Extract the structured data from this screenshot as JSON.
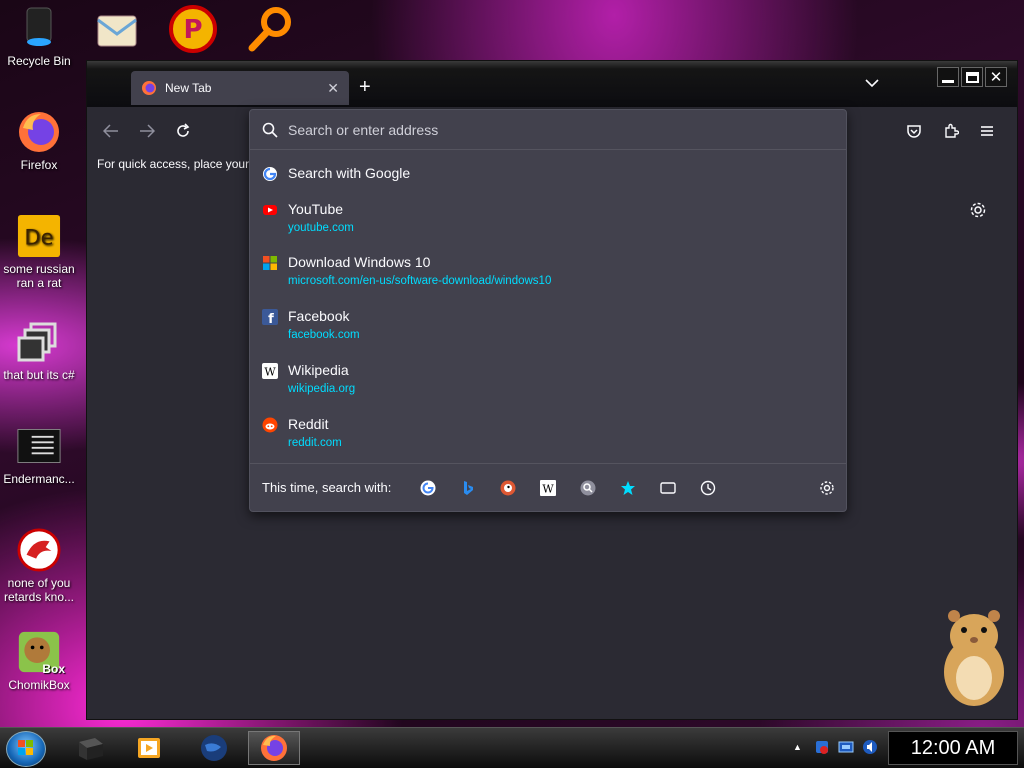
{
  "desktop": {
    "icons": [
      {
        "label": "Recycle Bin"
      },
      {
        "label": "Firefox"
      },
      {
        "label": "some russian ran a rat"
      },
      {
        "label": "that but its c#"
      },
      {
        "label": "Endermanc..."
      },
      {
        "label": "none of you retards kno..."
      },
      {
        "label": "ChomikBox"
      }
    ],
    "badge_text": "Box"
  },
  "browser": {
    "tab_title": "New Tab",
    "bookmarks_hint": "For quick access, place your b",
    "url_placeholder": "Search or enter address",
    "suggestions": [
      {
        "title": "Search with Google",
        "url": "",
        "icon": "google-icon"
      },
      {
        "title": "YouTube",
        "url": "youtube.com",
        "icon": "youtube-icon"
      },
      {
        "title": "Download Windows 10",
        "url": "microsoft.com/en-us/software-download/windows10",
        "icon": "microsoft-icon"
      },
      {
        "title": "Facebook",
        "url": "facebook.com",
        "icon": "facebook-icon"
      },
      {
        "title": "Wikipedia",
        "url": "wikipedia.org",
        "icon": "wikipedia-icon"
      },
      {
        "title": "Reddit",
        "url": "reddit.com",
        "icon": "reddit-icon"
      }
    ],
    "one_off_label": "This time, search with:",
    "search_engines": [
      "google",
      "bing",
      "duckduckgo",
      "wikipedia",
      "search",
      "bookmarks",
      "tabs",
      "history"
    ]
  },
  "taskbar": {
    "clock": "12:00 AM"
  },
  "colors": {
    "accent_url": "#00ddff",
    "popup_bg": "#42414d",
    "window_bg": "#2b2a33"
  }
}
